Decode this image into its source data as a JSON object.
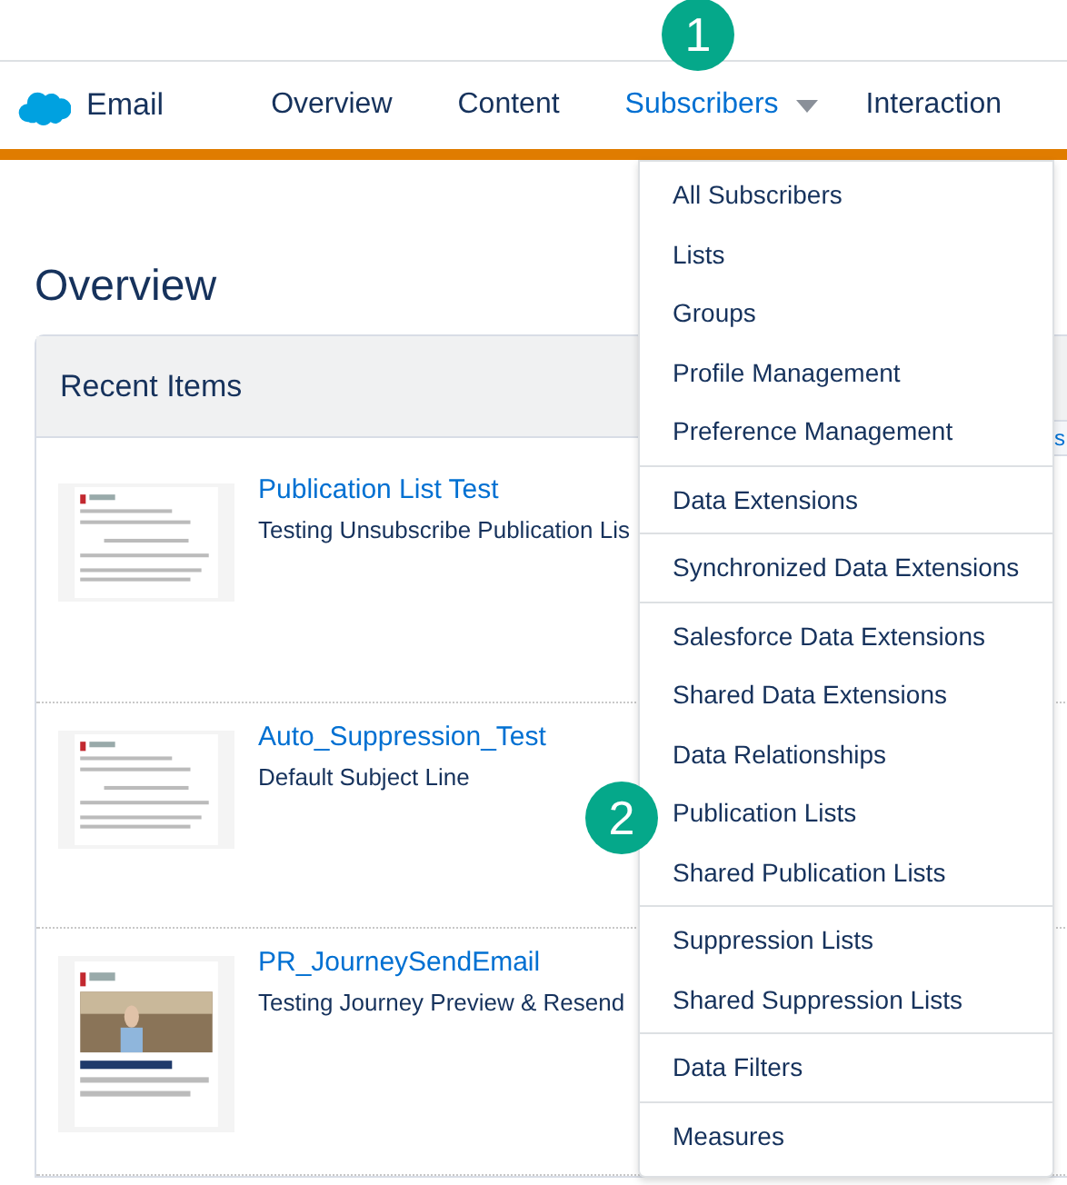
{
  "header": {
    "app_name": "Email",
    "nav": [
      {
        "label": "Overview",
        "selected": false,
        "has_menu": false
      },
      {
        "label": "Content",
        "selected": false,
        "has_menu": false
      },
      {
        "label": "Subscribers",
        "selected": true,
        "has_menu": true
      },
      {
        "label": "Interaction",
        "selected": false,
        "has_menu": false
      }
    ]
  },
  "callouts": [
    "1",
    "2"
  ],
  "page": {
    "title": "Overview",
    "edge_button": "s",
    "recent_items": {
      "title": "Recent Items",
      "items": [
        {
          "name": "Publication List Test",
          "subject": "Testing Unsubscribe Publication Lis",
          "kind": "picture"
        },
        {
          "name": "Auto_Suppression_Test",
          "subject": "Default Subject Line",
          "kind": "picture"
        },
        {
          "name": "PR_JourneySendEmail",
          "subject": "Testing Journey Preview & Resend",
          "kind": "picture"
        }
      ]
    }
  },
  "menu": {
    "groups": [
      [
        "All Subscribers",
        "Lists",
        "Groups",
        "Profile Management",
        "Preference Management"
      ],
      [
        "Data Extensions"
      ],
      [
        "Synchronized Data Extensions"
      ],
      [
        "Salesforce Data Extensions",
        "Shared Data Extensions",
        "Data Relationships",
        "Publication Lists",
        "Shared Publication Lists"
      ],
      [
        "Suppression Lists",
        "Shared Suppression Lists"
      ],
      [
        "Data Filters"
      ],
      [
        "Measures"
      ]
    ]
  }
}
